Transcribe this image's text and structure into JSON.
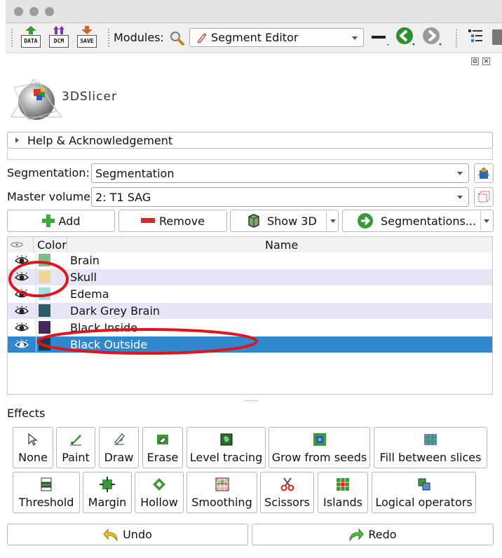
{
  "toolbar": {
    "data_label": "DATA",
    "dcm_label": "DCM",
    "save_label": "SAVE",
    "modules_label": "Modules:",
    "module_selected": "Segment Editor"
  },
  "logo": {
    "text": "3DSlicer"
  },
  "help": {
    "label": "Help & Acknowledgement"
  },
  "segmentation": {
    "label": "Segmentation:",
    "value": "Segmentation"
  },
  "master_volume": {
    "label": "Master volume:",
    "value": "2: T1 SAG"
  },
  "actions": {
    "add": "Add",
    "remove": "Remove",
    "show3d": "Show 3D",
    "segmentations": "Segmentations..."
  },
  "table": {
    "col_color": "Color",
    "col_name": "Name",
    "rows": [
      {
        "name": "Brain",
        "color": "#86b98a",
        "selected": false,
        "alt": false
      },
      {
        "name": "Skull",
        "color": "#f2d696",
        "selected": false,
        "alt": true
      },
      {
        "name": "Edema",
        "color": "#9edfe2",
        "selected": false,
        "alt": false
      },
      {
        "name": "Dark Grey Brain",
        "color": "#2f5a68",
        "selected": false,
        "alt": true
      },
      {
        "name": "Black Inside",
        "color": "#4a2660",
        "selected": false,
        "alt": false
      },
      {
        "name": "Black Outside",
        "color": "#1d3a4a",
        "selected": true,
        "alt": false
      }
    ]
  },
  "effects": {
    "title": "Effects",
    "row1": [
      "None",
      "Paint",
      "Draw",
      "Erase",
      "Level tracing",
      "Grow from seeds",
      "Fill between slices"
    ],
    "row2": [
      "Threshold",
      "Margin",
      "Hollow",
      "Smoothing",
      "Scissors",
      "Islands",
      "Logical operators"
    ]
  },
  "undo_label": "Undo",
  "redo_label": "Redo",
  "colors": {
    "selection": "#3088cf",
    "alt_row": "#e6e6f6",
    "annotation": "#e0141c"
  }
}
